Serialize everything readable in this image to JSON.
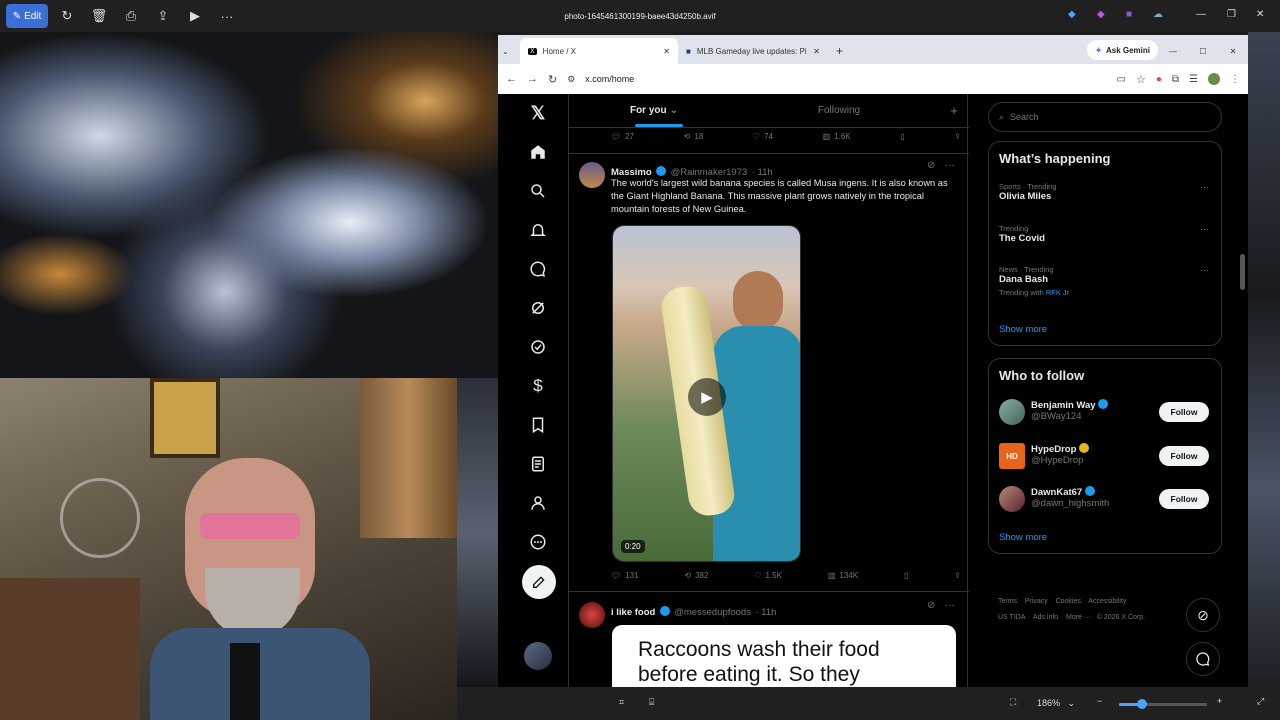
{
  "viewer": {
    "edit_label": "Edit",
    "file_title": "photo-1645461300199-baee43d4250b.avif",
    "zoom": "186%"
  },
  "browser": {
    "tabs": [
      {
        "label": "Home / X"
      },
      {
        "label": "MLB Gameday live updates: Pir"
      }
    ],
    "ask_gemini": "Ask Gemini",
    "url": "x.com/home"
  },
  "timeline": {
    "tab_for_you": "For you",
    "tab_following": "Following",
    "top_actions": {
      "replies": "27",
      "reposts": "18",
      "likes": "74",
      "views": "1.6K"
    },
    "tweet1": {
      "name": "Massimo",
      "handle": "@Rainmaker1973",
      "time": "· 11h",
      "text": "The world's largest wild banana species is called Musa ingens. It is also known as the Giant Highland Banana. This massive plant grows natively in the tropical mountain forests of New Guinea.",
      "video_duration": "0:20",
      "replies": "131",
      "reposts": "382",
      "likes": "1.5K",
      "views": "134K"
    },
    "tweet2": {
      "name": "i like food",
      "handle": "@messedupfoods",
      "time": "· 11h",
      "image_text": "Raccoons wash their food before eating it. So they"
    }
  },
  "sidebar": {
    "search_placeholder": "Search",
    "whats_happening": "What’s happening",
    "trends": [
      {
        "meta": "Sports · Trending",
        "name": "Olivia Miles",
        "extra": ""
      },
      {
        "meta": "Trending",
        "name": "The Covid",
        "extra": ""
      },
      {
        "meta": "News · Trending",
        "name": "Dana Bash",
        "extra": "Trending with",
        "extra_link": "RFK Jr"
      }
    ],
    "show_more": "Show more",
    "who_to_follow": "Who to follow",
    "follows": [
      {
        "name": "Benjamin Way",
        "handle": "@BWay124",
        "button": "Follow"
      },
      {
        "name": "HypeDrop",
        "handle": "@HypeDrop",
        "button": "Follow"
      },
      {
        "name": "DawnKat67",
        "handle": "@dawn_highsmith",
        "button": "Follow"
      }
    ],
    "show_more_2": "Show more",
    "footer": [
      "Terms",
      "Privacy",
      "Cookies",
      "Accessibility",
      "US TIDA",
      "Ads info",
      "More ···",
      "© 2026 X Corp."
    ]
  }
}
